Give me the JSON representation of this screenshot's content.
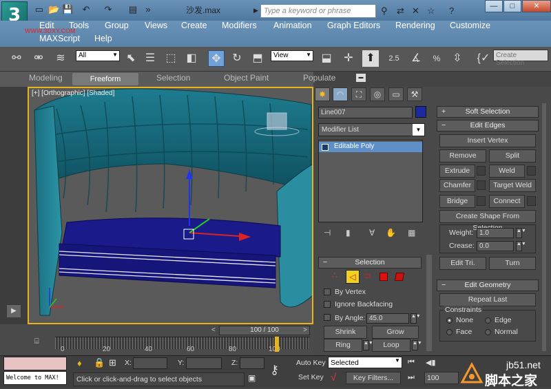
{
  "title_bar": {
    "app_logo": "3",
    "document_title": "沙发.max",
    "search_placeholder": "Type a keyword or phrase",
    "window_buttons": [
      "—",
      "□",
      "✕"
    ]
  },
  "menu": {
    "items": [
      "Edit",
      "Tools",
      "Group",
      "Views",
      "Create",
      "Modifiers",
      "Animation",
      "Graph Editors",
      "Rendering",
      "Customize",
      "MAXScript",
      "Help"
    ],
    "watermark": "WWW.3DXY.COM"
  },
  "toolbar": {
    "selection_filter": "All",
    "reference_coord": "View",
    "snap_labels": [
      "2.5",
      "%"
    ],
    "create_selection_placeholder": "Create Selection"
  },
  "ribbon": {
    "tabs": [
      "Modeling",
      "Freeform",
      "Selection",
      "Object Paint",
      "Populate"
    ],
    "active_tab": "Freeform"
  },
  "viewport": {
    "label": "[+] [Orthographic] [Shaded]"
  },
  "command_panel": {
    "object_name": "Line007",
    "object_color": "#1b2aa0",
    "modifier_list": "Modifier List",
    "stack_item": "Editable Poly",
    "soft_selection": "Soft Selection",
    "edit_edges": {
      "title": "Edit Edges",
      "insert_vertex": "Insert Vertex",
      "remove": "Remove",
      "split": "Split",
      "extrude": "Extrude",
      "weld": "Weld",
      "chamfer": "Chamfer",
      "target_weld": "Target Weld",
      "bridge": "Bridge",
      "connect": "Connect",
      "create_shape": "Create Shape From Selection",
      "weight_label": "Weight:",
      "weight_value": "1.0",
      "crease_label": "Crease:",
      "crease_value": "0.0",
      "edit_tri": "Edit Tri.",
      "turn": "Turn"
    },
    "edit_geometry": {
      "title": "Edit Geometry",
      "repeat_last": "Repeat Last",
      "constraints_label": "Constraints",
      "none": "None",
      "edge": "Edge",
      "face": "Face",
      "normal": "Normal"
    },
    "selection": {
      "title": "Selection",
      "by_vertex": "By Vertex",
      "ignore_backfacing": "Ignore Backfacing",
      "by_angle": "By Angle:",
      "angle_value": "45.0",
      "shrink": "Shrink",
      "grow": "Grow",
      "ring": "Ring",
      "loop": "Loop"
    }
  },
  "timeline": {
    "slider": "100 / 100",
    "ticks": [
      "0",
      "20",
      "40",
      "60",
      "80",
      "100"
    ]
  },
  "status": {
    "maxscript_output": "Welcome to MAX!",
    "prompt": "Click or click-and-drag to select objects",
    "x_label": "X:",
    "y_label": "Y:",
    "z_label": "Z:",
    "auto_key": "Auto Key",
    "set_key": "Set Key",
    "selected": "Selected",
    "key_filters": "Key Filters...",
    "frame": "100"
  },
  "watermarks": {
    "site_url": "jb51.net",
    "site_name": "脚本之家"
  }
}
